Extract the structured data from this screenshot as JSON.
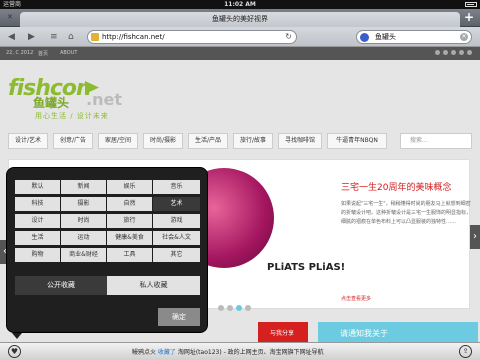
{
  "status": {
    "carrier": "运营商 ",
    "time": "11:02 AM"
  },
  "browser": {
    "tab_title": "鱼罐头的美好视界",
    "url": "http://fishcan.net/",
    "search_query": "鱼罐头",
    "icons": {
      "back": "back-arrow-icon",
      "forward": "forward-arrow-icon",
      "refresh": "refresh-icon",
      "add_tab": "plus-icon"
    }
  },
  "site": {
    "topnav": {
      "year": "22, C 2012",
      "first": "首页",
      "about": "ABOUT"
    },
    "logo": {
      "word": "fishcon",
      "cn": "鱼罐头",
      "net": ".net",
      "slogan": "用心生活 / 设计未来"
    },
    "categories": [
      "设计/艺术",
      "创意/广告",
      "家居/空间",
      "时尚/摄影",
      "生活/产品",
      "旅行/故事",
      "寻找咖啡馆",
      "牛逼青年NBQN"
    ],
    "search_placeholder": "搜索...",
    "slide": {
      "tag": "PLiATS PLiAS!",
      "title": "三宅一生20周年的美味概念",
      "text": "如果说起\"三宅一生\"，稍稍懂得时尚的朋友马上就想到细密的折皱设计吧。这种折皱设计是三宅一生服饰的明显指标，细腻的褶痕在单色布料上可以凸显服装的独特性……",
      "more": "点击查看更多"
    },
    "bottom_ads": {
      "left": "与我分享",
      "right": "请通知我关于"
    }
  },
  "overlay": {
    "tags": [
      [
        "默认",
        "新闻",
        "娱乐",
        "音乐"
      ],
      [
        "科技",
        "摄影",
        "自然",
        "艺术"
      ],
      [
        "设计",
        "时尚",
        "旅行",
        "游戏"
      ],
      [
        "生活",
        "运动",
        "健康&美食",
        "社会&人文"
      ],
      [
        "购物",
        "商业&财经",
        "工具",
        "其它"
      ]
    ],
    "selected": "艺术",
    "public_label": "公开收藏",
    "private_label": "私人收藏",
    "confirm_label": "确定"
  },
  "bottombar": {
    "prefix": "鳗鸦点火 ",
    "save": "收藏了",
    "rest": " 淘网址(tao123) - 政的上网主页、淘宝网旗下网址导航"
  },
  "colors": {
    "accent": "#8cbb2f",
    "highlight": "#d52020",
    "dot_active": "#6ccbe0"
  }
}
